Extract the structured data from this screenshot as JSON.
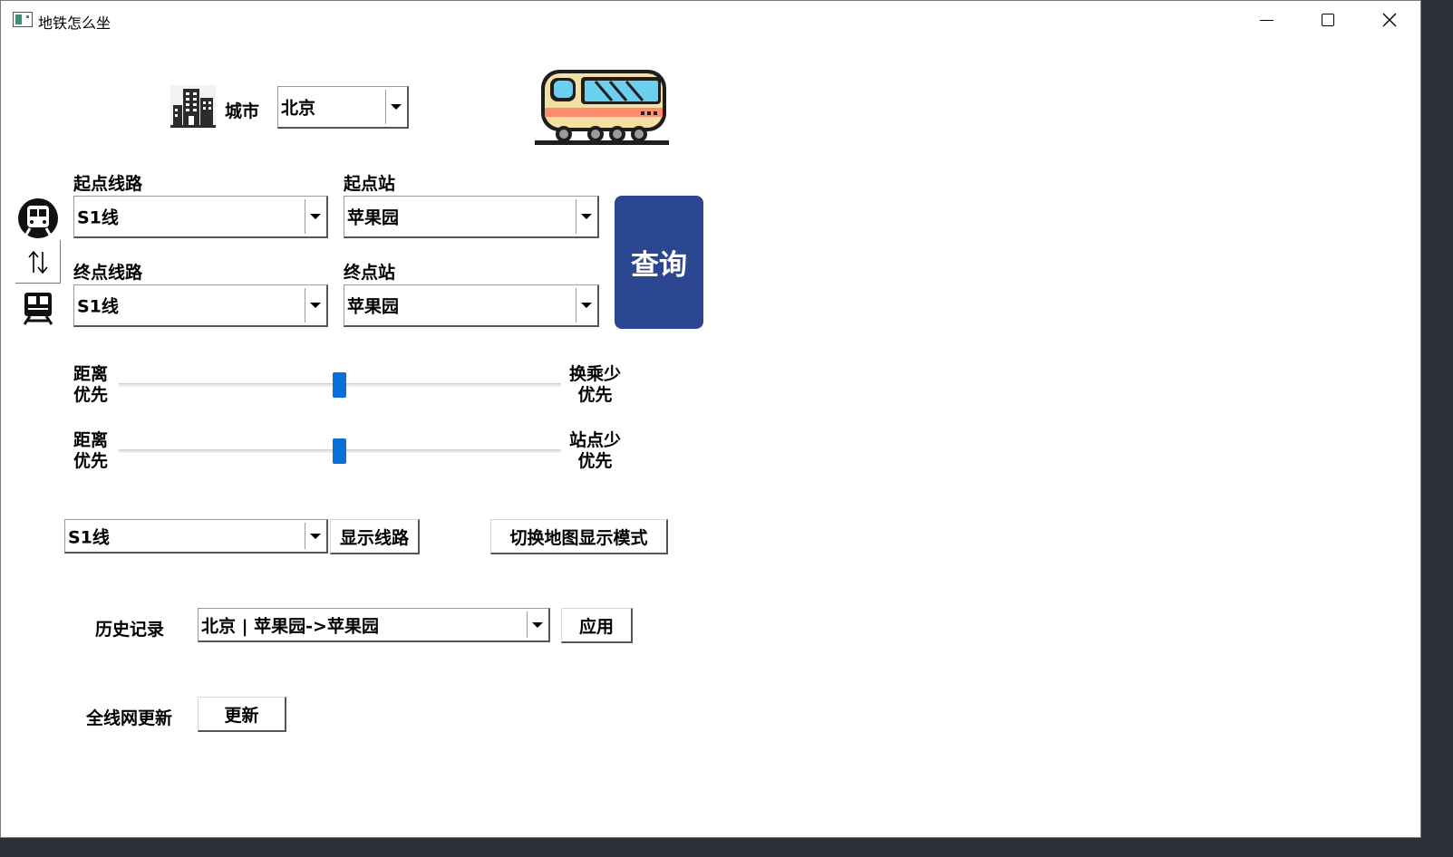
{
  "window": {
    "title": "地铁怎么坐"
  },
  "city": {
    "label": "城市",
    "value": "北京"
  },
  "start": {
    "line_label": "起点线路",
    "line_value": "S1线",
    "station_label": "起点站",
    "station_value": "苹果园"
  },
  "end": {
    "line_label": "终点线路",
    "line_value": "S1线",
    "station_label": "终点站",
    "station_value": "苹果园"
  },
  "query_button": "查询",
  "sliders": [
    {
      "left_label_1": "距离",
      "left_label_2": "优先",
      "right_label_1": "换乘少",
      "right_label_2": "优先",
      "value": 0.5
    },
    {
      "left_label_1": "距离",
      "left_label_2": "优先",
      "right_label_1": "站点少",
      "right_label_2": "优先",
      "value": 0.5
    }
  ],
  "line_display": {
    "value": "S1线",
    "button": "显示线路"
  },
  "map_mode_button": "切换地图显示模式",
  "history": {
    "label": "历史记录",
    "value": "北京 | 苹果园->苹果园",
    "apply_button": "应用"
  },
  "update": {
    "label": "全线网更新",
    "button": "更新"
  },
  "colors": {
    "query_button": "#2b4791",
    "slider_thumb": "#0a6fd8"
  }
}
